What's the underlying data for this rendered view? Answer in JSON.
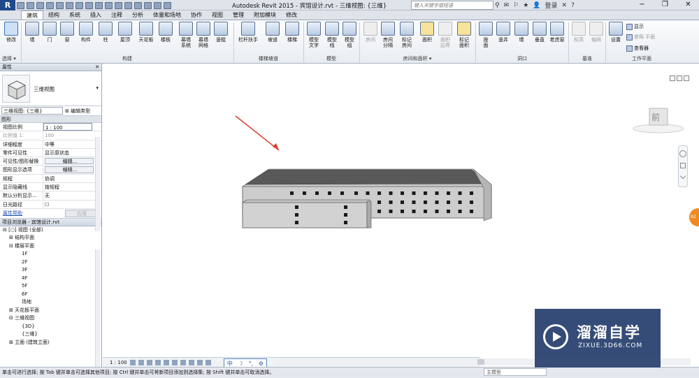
{
  "app": {
    "logo": "R",
    "title": "Autodesk Revit 2015 -    宾馆设计.rvt - 三维视图: {三维}",
    "search_placeholder": "键入关键字或短语",
    "login": "登录",
    "help": "?"
  },
  "tabs": [
    "建筑",
    "结构",
    "系统",
    "插入",
    "注释",
    "分析",
    "体量和场地",
    "协作",
    "视图",
    "管理",
    "附加模块",
    "修改"
  ],
  "active_tab": "建筑",
  "ribbon": {
    "select_label": "选择 ▾",
    "buttons": {
      "modify": "修改",
      "wall": "墙",
      "door": "门",
      "window": "窗",
      "component": "构件",
      "column": "柱",
      "roof": "屋顶",
      "ceiling": "天花板",
      "floor": "楼板",
      "curtain_system": "幕墙\n系统",
      "curtain_grid": "幕墙\n网格",
      "mullion": "竖梃",
      "railing": "栏杆扶手",
      "ramp": "坡道",
      "stair": "楼梯",
      "model_text": "模型\n文字",
      "model_line": "模型\n线",
      "model_group": "模型\n组",
      "room": "房间",
      "room_separator": "房间\n分隔",
      "tag_room": "标记\n房间",
      "area": "面积",
      "area_boundary": "面积\n边界",
      "tag_area": "标记\n面积",
      "by_face": "按\n面",
      "shaft": "竖井",
      "wall_opening": "墙",
      "vertical": "垂直",
      "dormer": "老虎窗",
      "level": "标高",
      "grid": "轴网",
      "set": "设置",
      "show": "显示",
      "ref_plane": "参照 平面",
      "viewer": "查看器"
    },
    "panels": {
      "build": "构建",
      "circulation": "楼梯坡道",
      "model": "模型",
      "room_area": "房间和面积 ▾",
      "opening": "洞口",
      "datum": "基准",
      "work_plane": "工作平面"
    }
  },
  "properties": {
    "header": "属性",
    "type_name": "三维视图",
    "instance_label": "三维视图: {三维}",
    "edit_type": "编辑类型",
    "group": "图形",
    "rows": [
      {
        "k": "视图比例",
        "v": "1 : 100",
        "style": "box"
      },
      {
        "k": "比例值 1:",
        "v": "100",
        "style": "grey"
      },
      {
        "k": "详细程度",
        "v": "中等",
        "style": ""
      },
      {
        "k": "零件可见性",
        "v": "显示原状态",
        "style": ""
      },
      {
        "k": "可见性/图形替换",
        "v": "编辑...",
        "style": "btn"
      },
      {
        "k": "图形显示选项",
        "v": "编辑...",
        "style": "btn"
      },
      {
        "k": "规程",
        "v": "协调",
        "style": ""
      },
      {
        "k": "显示隐藏线",
        "v": "按规程",
        "style": ""
      },
      {
        "k": "默认分析显示...",
        "v": "无",
        "style": ""
      },
      {
        "k": "日光路径",
        "v": "☐",
        "style": ""
      }
    ],
    "help_link": "属性帮助",
    "apply": "应用"
  },
  "browser": {
    "header": "项目浏览器 - 宾馆设计.rvt",
    "nodes": [
      {
        "t": "⊟ [○] 视图 (全部)",
        "d": 0
      },
      {
        "t": "⊞ 结构平面",
        "d": 1
      },
      {
        "t": "⊟ 楼层平面",
        "d": 1
      },
      {
        "t": "1F",
        "d": 3
      },
      {
        "t": "2F",
        "d": 3
      },
      {
        "t": "3F",
        "d": 3
      },
      {
        "t": "4F",
        "d": 3
      },
      {
        "t": "5F",
        "d": 3
      },
      {
        "t": "6F",
        "d": 3
      },
      {
        "t": "场地",
        "d": 3
      },
      {
        "t": "⊞ 天花板平面",
        "d": 1
      },
      {
        "t": "⊟ 三维视图",
        "d": 1
      },
      {
        "t": "{3D}",
        "d": 3
      },
      {
        "t": "{三维}",
        "d": 3
      },
      {
        "t": "⊞ 立面 (建筑立面)",
        "d": 1
      }
    ]
  },
  "view_control": {
    "scale": "1 : 100"
  },
  "ime": {
    "lang": "中",
    "moon": "☽",
    "punct": "°,",
    "gear": "⚙"
  },
  "viewcube_face": "前",
  "orange_badge": "82",
  "status": {
    "text": "单击可进行选择; 按 Tab 键并单击可选择其他项目; 按 Ctrl 键并单击可将新项目添加到选择集; 按 Shift 键并单击可取消选择。",
    "model": "主模型"
  },
  "watermark": {
    "cn": "溜溜自学",
    "en": "ZIXUE.3D66.COM"
  },
  "colors": {
    "ribbon_accent": "#1f4a8c",
    "building_top": "#5c5c5c",
    "building_wall": "#c9c9c9",
    "arrow": "#e0392b",
    "watermark_bg": "#2c4371"
  }
}
